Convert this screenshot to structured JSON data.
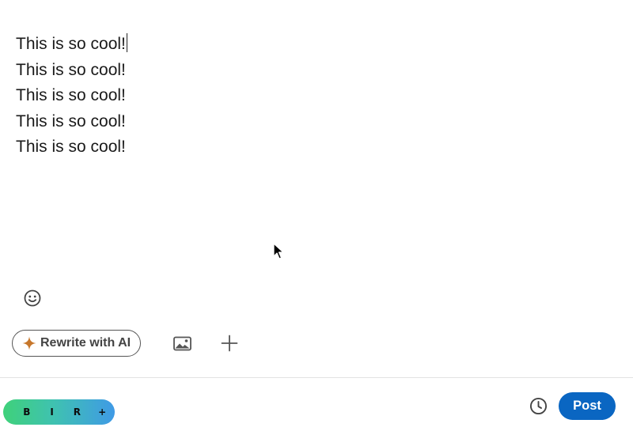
{
  "editor": {
    "lines": [
      "This is so cool!",
      "This is so cool!",
      "This is so cool!",
      "This is so cool!",
      "This is so cool!"
    ]
  },
  "toolbar": {
    "rewrite_label": "Rewrite with AI",
    "icons": {
      "emoji": "emoji-smiley-icon",
      "sparkle": "sparkle-icon",
      "image": "image-icon",
      "add": "plus-icon"
    }
  },
  "format_bar": {
    "buttons": [
      "B",
      "I",
      "R",
      "+"
    ]
  },
  "footer": {
    "schedule_icon": "clock-icon",
    "post_label": "Post"
  },
  "colors": {
    "post_button": "#0a66c2",
    "sparkle": "#c7772b",
    "format_gradient_start": "#3fd17a",
    "format_gradient_end": "#3f9ae6"
  }
}
